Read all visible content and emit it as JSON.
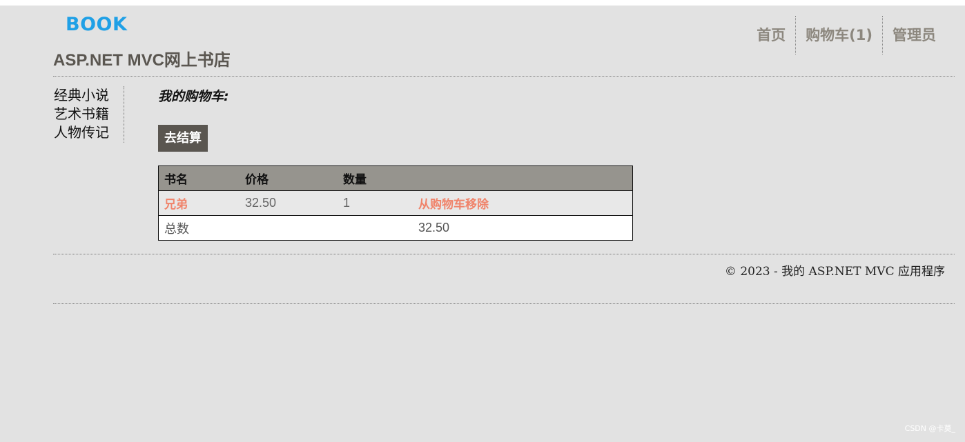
{
  "header": {
    "logo_text": "BOOK",
    "site_title": "ASP.NET MVC网上书店",
    "nav": [
      {
        "label": "首页"
      },
      {
        "label": "购物车(1)"
      },
      {
        "label": "管理员"
      }
    ]
  },
  "sidebar": {
    "items": [
      {
        "label": "经典小说"
      },
      {
        "label": "艺术书籍"
      },
      {
        "label": "人物传记"
      }
    ]
  },
  "main": {
    "cart_title": "我的购物车:",
    "checkout_label": "去结算",
    "table": {
      "columns": [
        "书名",
        "价格",
        "数量",
        ""
      ],
      "rows": [
        {
          "title": "兄弟",
          "price": "32.50",
          "quantity": "1",
          "action": "从购物车移除"
        }
      ],
      "total_label": "总数",
      "total_value": "32.50"
    }
  },
  "footer": {
    "copyright": "© 2023 - 我的 ASP.NET MVC 应用程序"
  },
  "watermark": "CSDN @卡莫_",
  "colors": {
    "logo": "#1fa0e6",
    "link": "#f0836a",
    "button_bg": "#5a5650",
    "table_header_bg": "#96948e",
    "page_bg": "#e2e2e2"
  }
}
